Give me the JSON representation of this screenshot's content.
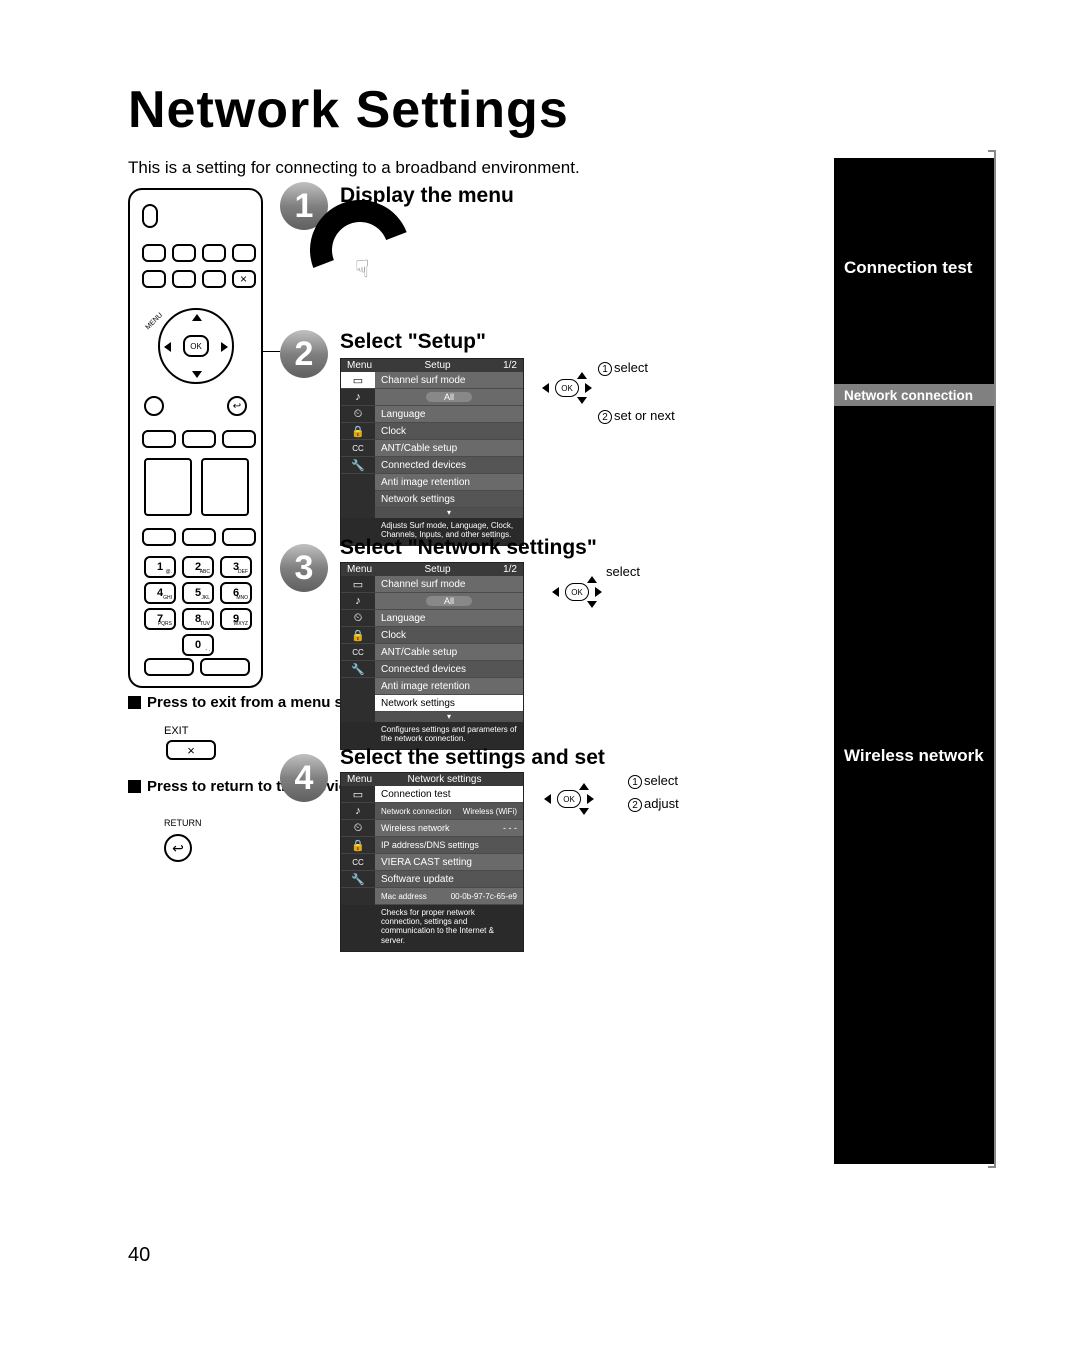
{
  "page": {
    "title": "Network Settings",
    "intro": "This is a setting for connecting to a broadband environment.",
    "number": "40"
  },
  "remote": {
    "menu_label": "MENU",
    "ok_label": "OK",
    "return_symbol": "↩",
    "keys": [
      {
        "n": "1",
        "s": "@."
      },
      {
        "n": "2",
        "s": "ABC"
      },
      {
        "n": "3",
        "s": "DEF"
      },
      {
        "n": "4",
        "s": "GHI"
      },
      {
        "n": "5",
        "s": "JKL"
      },
      {
        "n": "6",
        "s": "MNO"
      },
      {
        "n": "7",
        "s": "PQRS"
      },
      {
        "n": "8",
        "s": "TUV"
      },
      {
        "n": "9",
        "s": "WXYZ"
      },
      {
        "n": "0",
        "s": "- ."
      }
    ]
  },
  "hints": {
    "exit_title": "Press to exit from a menu screen",
    "exit_label": "EXIT",
    "exit_x": "×",
    "return_title": "Press to return to the previous screen",
    "return_label": "RETURN"
  },
  "steps": {
    "s1": {
      "num": "1",
      "title": "Display the menu"
    },
    "s2": {
      "num": "2",
      "title": "Select \"Setup\"",
      "nav": {
        "a": "select",
        "b": "set or next"
      },
      "menu": {
        "header_left": "Menu",
        "header_center": "Setup",
        "header_right": "1/2",
        "rows": [
          {
            "label": "Channel surf mode",
            "type": "plain"
          },
          {
            "label": "All",
            "type": "pill"
          },
          {
            "label": "Language",
            "type": "plain"
          },
          {
            "label": "Clock",
            "type": "dark"
          },
          {
            "label": "ANT/Cable setup",
            "type": "plain"
          },
          {
            "label": "Connected devices",
            "type": "dark"
          },
          {
            "label": "Anti image retention",
            "type": "plain"
          },
          {
            "label": "Network settings",
            "type": "dark"
          }
        ],
        "footer": "Adjusts Surf mode, Language, Clock, Channels, Inputs, and other settings."
      }
    },
    "s3": {
      "num": "3",
      "title": "Select \"Network settings\"",
      "nav": {
        "a": "select"
      },
      "menu": {
        "header_left": "Menu",
        "header_center": "Setup",
        "header_right": "1/2",
        "rows": [
          {
            "label": "Channel surf mode",
            "type": "plain"
          },
          {
            "label": "All",
            "type": "pill"
          },
          {
            "label": "Language",
            "type": "plain"
          },
          {
            "label": "Clock",
            "type": "dark"
          },
          {
            "label": "ANT/Cable setup",
            "type": "plain"
          },
          {
            "label": "Connected devices",
            "type": "dark"
          },
          {
            "label": "Anti image retention",
            "type": "plain"
          },
          {
            "label": "Network settings",
            "type": "hl"
          }
        ],
        "footer": "Configures settings and parameters of the network connection."
      }
    },
    "s4": {
      "num": "4",
      "title": "Select the settings and set",
      "nav": {
        "a": "select",
        "b": "adjust"
      },
      "menu": {
        "header_left": "Menu",
        "header_center": "Network settings",
        "header_right": "",
        "rows": [
          {
            "label": "Connection test",
            "type": "hl"
          },
          {
            "label": "Network connection",
            "value": "Wireless (WiFi)",
            "type": "val"
          },
          {
            "label": "Wireless network",
            "value": "- - -",
            "type": "val"
          },
          {
            "label": "IP address/DNS settings",
            "type": "dark"
          },
          {
            "label": "VIERA CAST setting",
            "type": "plain"
          },
          {
            "label": "Software update",
            "type": "dark"
          },
          {
            "label": "Mac address",
            "value": "00-0b-97-7c-65-e9",
            "type": "valdark"
          }
        ],
        "footer": "Checks for proper network connection, settings and communication to the Internet & server."
      }
    }
  },
  "sidebar": {
    "connection_test": "Connection test",
    "network_connection": "Network connection",
    "wireless_network": "Wireless network"
  },
  "nav_ok": "OK",
  "circ": {
    "one": "1",
    "two": "2"
  }
}
